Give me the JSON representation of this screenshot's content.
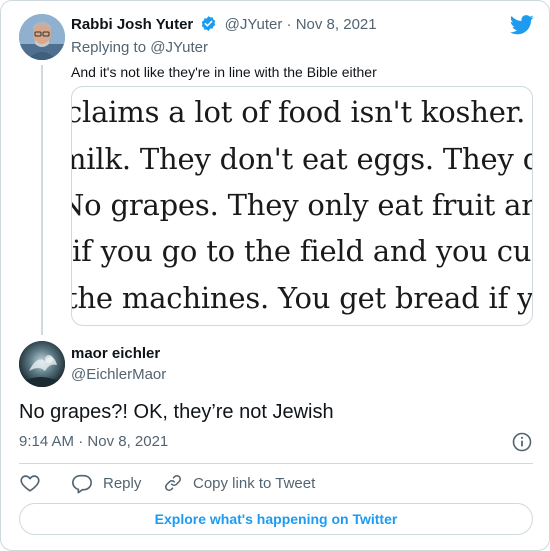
{
  "parent": {
    "name": "Rabbi Josh Yuter",
    "handle": "@JYuter",
    "separator": "·",
    "date": "Nov 8, 2021",
    "replying_prefix": "Replying to",
    "replying_to": "@JYuter",
    "text": "And it's not like they're in line with the Bible either",
    "media_lines": [
      "claims a lot of food isn't kosher. They",
      "milk. They don't eat eggs. They don't e",
      "No grapes. They only eat fruit and veg",
      "if you go to the field and you cut the",
      "the machines. You get bread if you're"
    ]
  },
  "reply": {
    "name": "maor eichler",
    "handle": "@EichlerMaor",
    "text": "No grapes?! OK, they’re not Jewish",
    "time": "9:14 AM",
    "separator": "·",
    "date": "Nov 8, 2021"
  },
  "actions": {
    "like_icon": "heart-icon",
    "reply_label": "Reply",
    "copy_label": "Copy link to Tweet"
  },
  "footer": {
    "explore_label": "Explore what's happening on Twitter"
  },
  "colors": {
    "accent": "#1d9bf0",
    "muted": "#536471",
    "border": "#cfd9de",
    "text": "#0f1419"
  }
}
